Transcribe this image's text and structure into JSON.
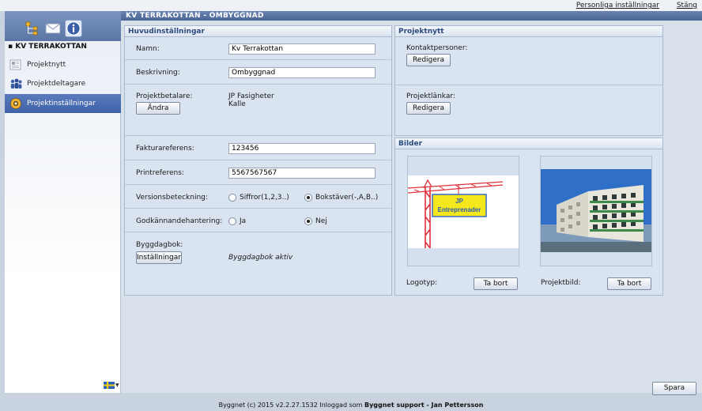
{
  "top": {
    "personal_settings": "Personliga inställningar",
    "close": "Stäng"
  },
  "window": {
    "title": "KV TERRAKOTTAN - OMBYGGNAD"
  },
  "sidebar": {
    "heading": "KV TERRAKOTTAN",
    "items": [
      {
        "label": "Projektnytt",
        "icon": "newspaper-icon"
      },
      {
        "label": "Projektdeltagare",
        "icon": "people-icon"
      },
      {
        "label": "Projektinställningar",
        "icon": "gear-icon",
        "active": true
      }
    ],
    "language": "flag-sweden-icon"
  },
  "main_settings": {
    "header": "Huvudinställningar",
    "name_label": "Namn:",
    "name_value": "Kv Terrakottan",
    "description_label": "Beskrivning:",
    "description_value": "Ombyggnad",
    "payer_label": "Projektbetalare:",
    "payer_line1": "JP Fasigheter",
    "payer_line2": "Kalle",
    "change_button": "Ändra",
    "invoice_ref_label": "Fakturareferens:",
    "invoice_ref_value": "123456",
    "print_ref_label": "Printreferens:",
    "print_ref_value": "5567567567",
    "version_label": "Versionsbeteckning:",
    "version_option_digits": "Siffror(1,2,3..)",
    "version_option_letters": "Bokstäver(-,A,B..)",
    "version_selected": "letters",
    "approval_label": "Godkännandehantering:",
    "approval_yes": "Ja",
    "approval_no": "Nej",
    "approval_selected": "no",
    "diary_label": "Byggdagbok:",
    "diary_settings_button": "Inställningar",
    "diary_status": "Byggdagbok aktiv"
  },
  "project_news": {
    "header": "Projektnytt",
    "contacts_label": "Kontaktpersoner:",
    "contacts_edit_button": "Redigera",
    "links_label": "Projektlänkar:",
    "links_edit_button": "Redigera"
  },
  "images": {
    "header": "Bilder",
    "logo_label": "Logotyp:",
    "logo_remove_button": "Ta bort",
    "logo_sign_line1": "JP",
    "logo_sign_line2": "Entreprenader",
    "project_image_label": "Projektbild:",
    "project_image_remove_button": "Ta bort"
  },
  "actions": {
    "save_button": "Spara"
  },
  "footer": {
    "copyright": "Byggnet (c) 2015  v2.2.27.1532  Inloggad som",
    "user": "Byggnet support - Jan Pettersson"
  },
  "colors": {
    "accent": "#4b6696",
    "active_item": "#3f61a7",
    "panel_header_text": "#2b4a7d",
    "logo_sign_yellow": "#f4e81c",
    "crane_red": "#e0303a"
  }
}
